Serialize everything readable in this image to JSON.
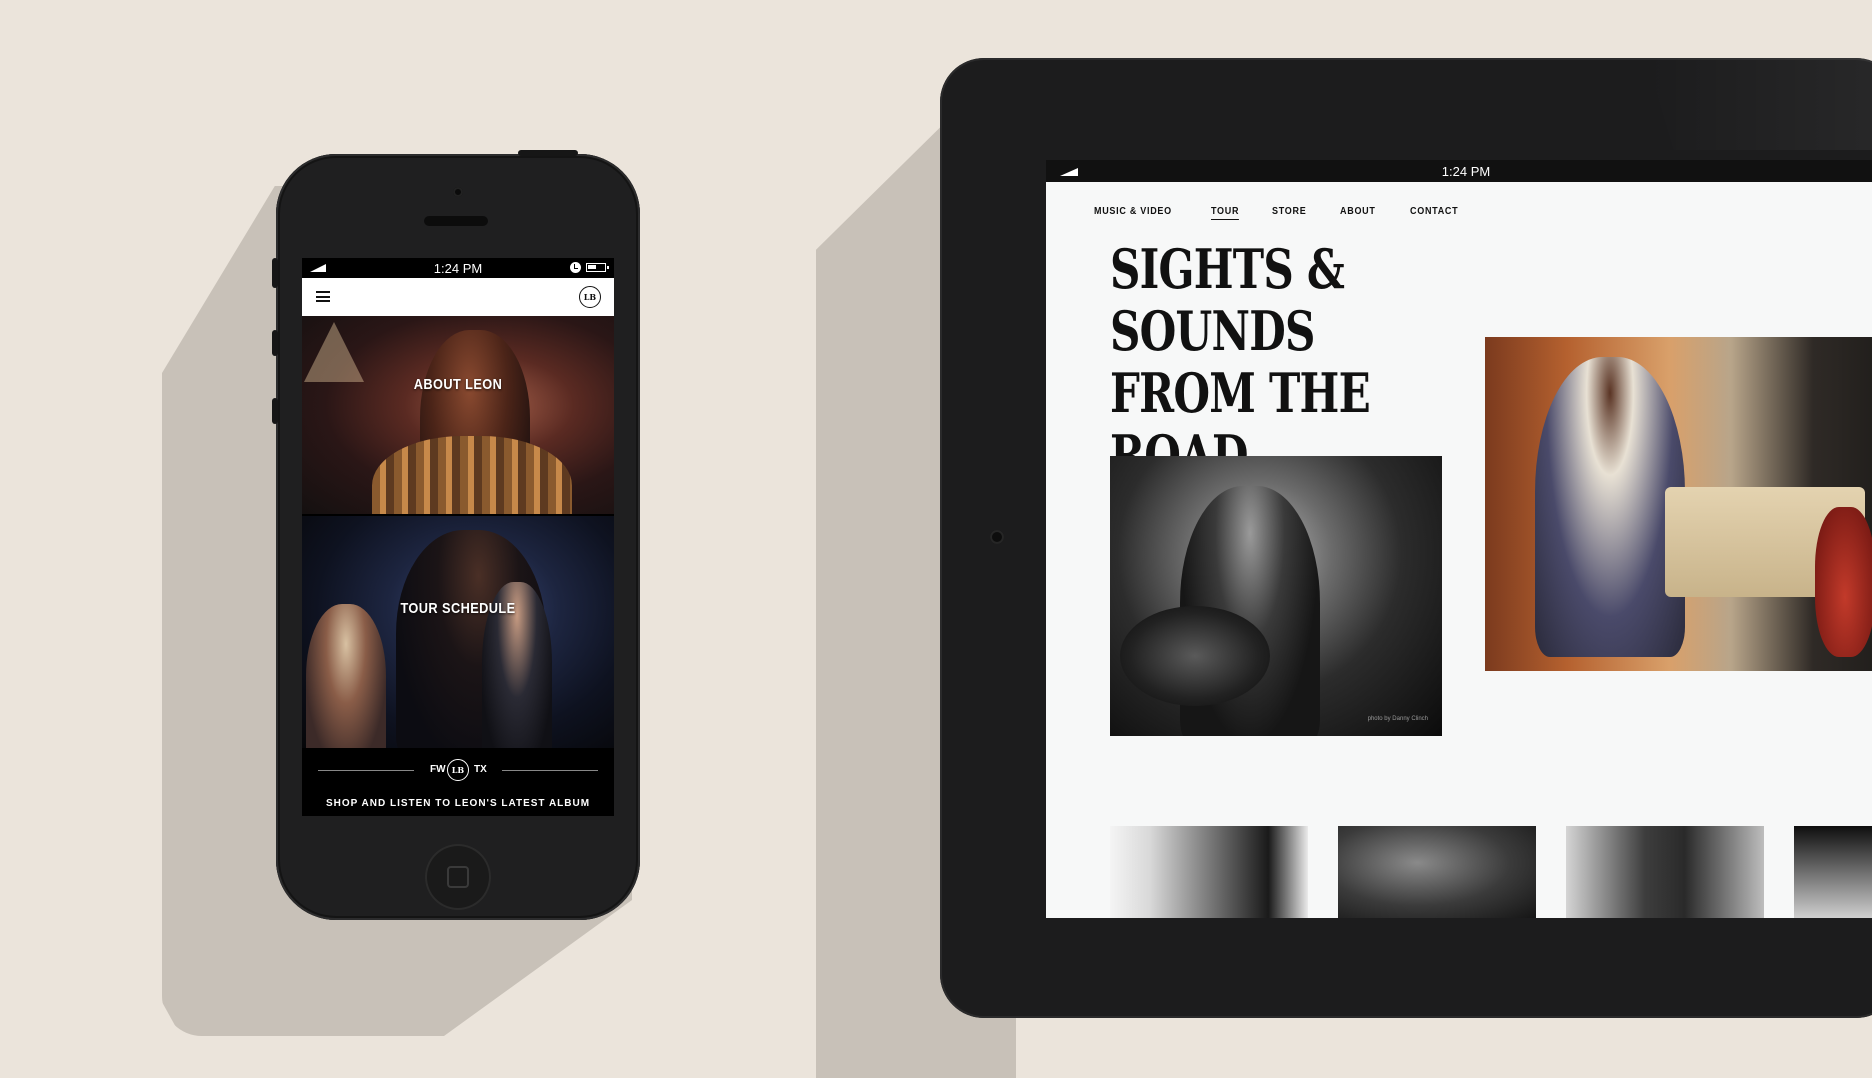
{
  "phone": {
    "status_time": "1:24 PM",
    "logo": "LB",
    "tiles": [
      {
        "label": "ABOUT LEON"
      },
      {
        "label": "TOUR SCHEDULE"
      }
    ],
    "footer": {
      "left": "FW",
      "right": "TX",
      "logo": "LB",
      "cta": "SHOP AND LISTEN TO LEON'S LATEST ALBUM"
    }
  },
  "tablet": {
    "status_time": "1:24 PM",
    "nav": [
      {
        "label": "MUSIC & VIDEO",
        "active": false
      },
      {
        "label": "TOUR",
        "active": true
      },
      {
        "label": "STORE",
        "active": false
      },
      {
        "label": "ABOUT",
        "active": false
      },
      {
        "label": "CONTACT",
        "active": false
      }
    ],
    "heading_line1": "SIGHTS & SOUNDS",
    "heading_line2": "FROM THE ROAD",
    "photo_credit": "photo by Danny Clinch"
  },
  "colors": {
    "background": "#ebe4db",
    "shadow": "#c8c1b8",
    "device_body": "#1f1f20",
    "page_bg": "#f7f8f8"
  }
}
